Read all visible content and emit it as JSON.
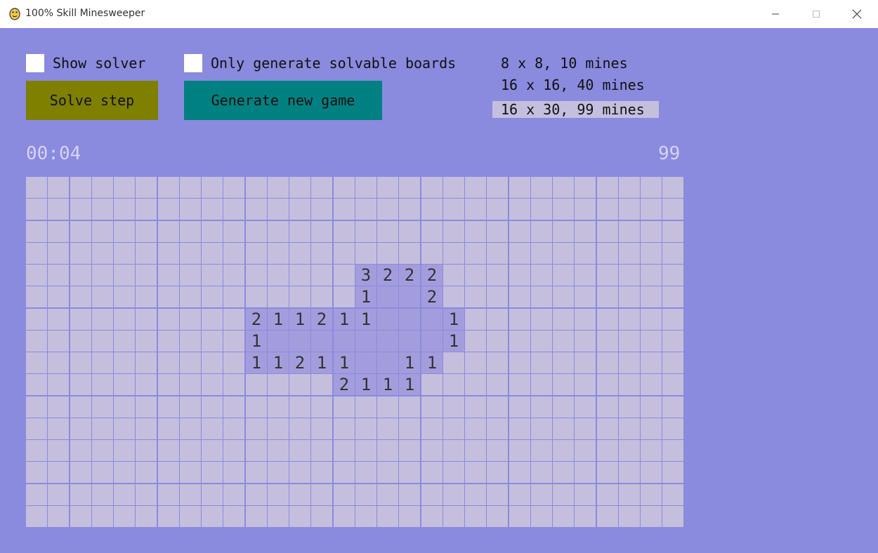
{
  "window": {
    "title": "100% Skill Minesweeper",
    "icon": "python-icon",
    "controls": [
      "minimize-icon",
      "maximize-icon",
      "close-icon"
    ]
  },
  "options": {
    "show_solver": {
      "label": "Show solver",
      "checked": false
    },
    "only_solvable": {
      "label": "Only generate solvable boards",
      "checked": false
    }
  },
  "buttons": {
    "solve_step": "Solve step",
    "generate": "Generate new game"
  },
  "presets": [
    {
      "label": "8 x 8, 10 mines",
      "selected": false
    },
    {
      "label": "16 x 16, 40 mines",
      "selected": false
    },
    {
      "label": "16 x 30, 99 mines",
      "selected": true
    }
  ],
  "status": {
    "timer": "00:04",
    "mines_remaining": "99"
  },
  "colors": {
    "background": "#8a8adf",
    "hidden_cell": "#c5bfdd",
    "revealed_cell": "#a49ddd",
    "solve_button": "#7f7f00",
    "generate_button": "#008080",
    "selected_preset": "#c4bfdd"
  },
  "board": {
    "rows": 16,
    "cols": 30,
    "legend": "# = hidden, . = revealed empty, digit = revealed number",
    "grid": [
      "##############################",
      "##############################",
      "##############################",
      "##############################",
      "###############3222###########",
      "###############1..2###########",
      "##########211211...1##########",
      "##########1........1##########",
      "##########11211..11###########",
      "##############2111############",
      "##############################",
      "##############################",
      "##############################",
      "##############################",
      "##############################",
      "##############################"
    ]
  }
}
